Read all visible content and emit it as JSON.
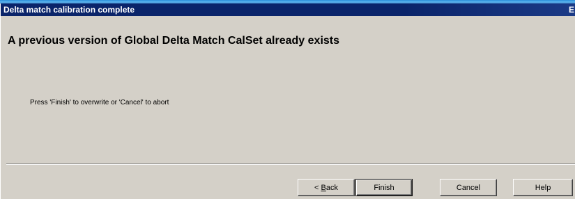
{
  "window": {
    "title": "Delta match calibration complete",
    "title_close_glyph": "E"
  },
  "content": {
    "heading": "A previous version of Global Delta Match CalSet already exists",
    "instruction": "Press 'Finish' to overwrite or 'Cancel' to abort"
  },
  "buttons": {
    "back_prefix": "< ",
    "back_mnemonic": "B",
    "back_rest": "ack",
    "finish": "Finish",
    "cancel": "Cancel",
    "help": "Help"
  },
  "colors": {
    "title_bar": "#0a246a",
    "dialog_bg": "#d4d0c8"
  }
}
